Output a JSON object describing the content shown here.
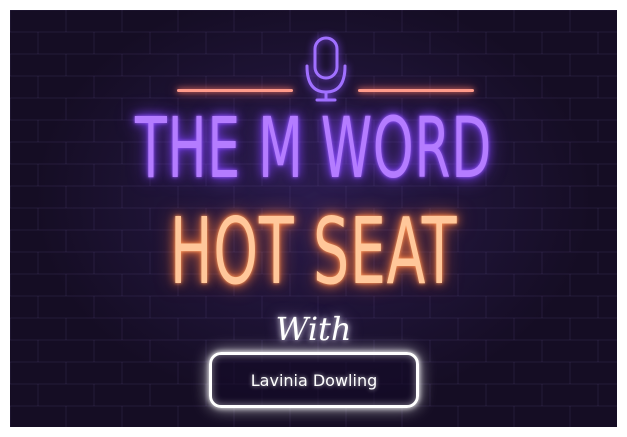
{
  "poster": {
    "title_line_1": "THE M WORD",
    "title_line_2": "HOT SEAT",
    "with_text": "With",
    "guest_name": "Lavinia Dowling",
    "mic_icon": "microphone-icon"
  },
  "colors": {
    "background": "#150d24",
    "title_line_1": "#b47cff",
    "title_line_2": "#ffc79a",
    "accent_lines": "#ff9a8a",
    "mic": "#a070ff",
    "name_box": "#ffffff"
  }
}
